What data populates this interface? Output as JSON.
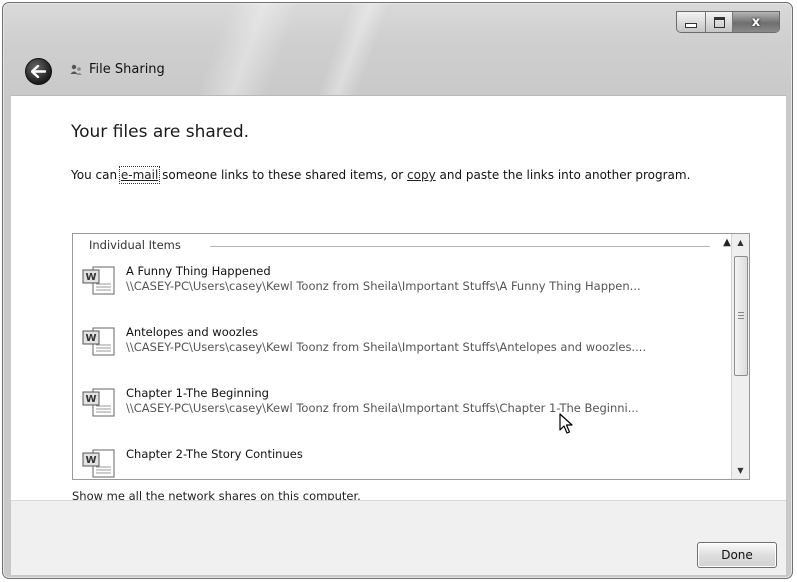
{
  "window": {
    "title": "File Sharing",
    "controls": {
      "minimize": "minimize",
      "maximize": "maximize",
      "close": "x"
    }
  },
  "main": {
    "heading": "Your files are shared.",
    "instruction": {
      "prefix": "You can ",
      "email_link": "e-mail",
      "middle": " someone links to these shared items, or ",
      "copy_link": "copy",
      "suffix": " and paste the links into another program."
    }
  },
  "list": {
    "group_header": "Individual Items",
    "items": [
      {
        "name": "A Funny Thing Happened",
        "path": "\\\\CASEY-PC\\Users\\casey\\Kewl Toonz from Sheila\\Important Stuffs\\A Funny Thing Happen..."
      },
      {
        "name": "Antelopes and woozles",
        "path": "\\\\CASEY-PC\\Users\\casey\\Kewl Toonz from Sheila\\Important Stuffs\\Antelopes and woozles...."
      },
      {
        "name": "Chapter 1-The Beginning",
        "path": "\\\\CASEY-PC\\Users\\casey\\Kewl Toonz from Sheila\\Important Stuffs\\Chapter 1-The Beginni..."
      },
      {
        "name": "Chapter 2-The Story Continues",
        "path": ""
      }
    ]
  },
  "footer": {
    "network_link": "Show me all the network shares on this computer.",
    "done_label": "Done"
  },
  "icons": {
    "back": "back-arrow-icon",
    "title": "file-sharing-icon",
    "document": "word-document-icon",
    "cursor": "mouse-pointer-icon"
  }
}
